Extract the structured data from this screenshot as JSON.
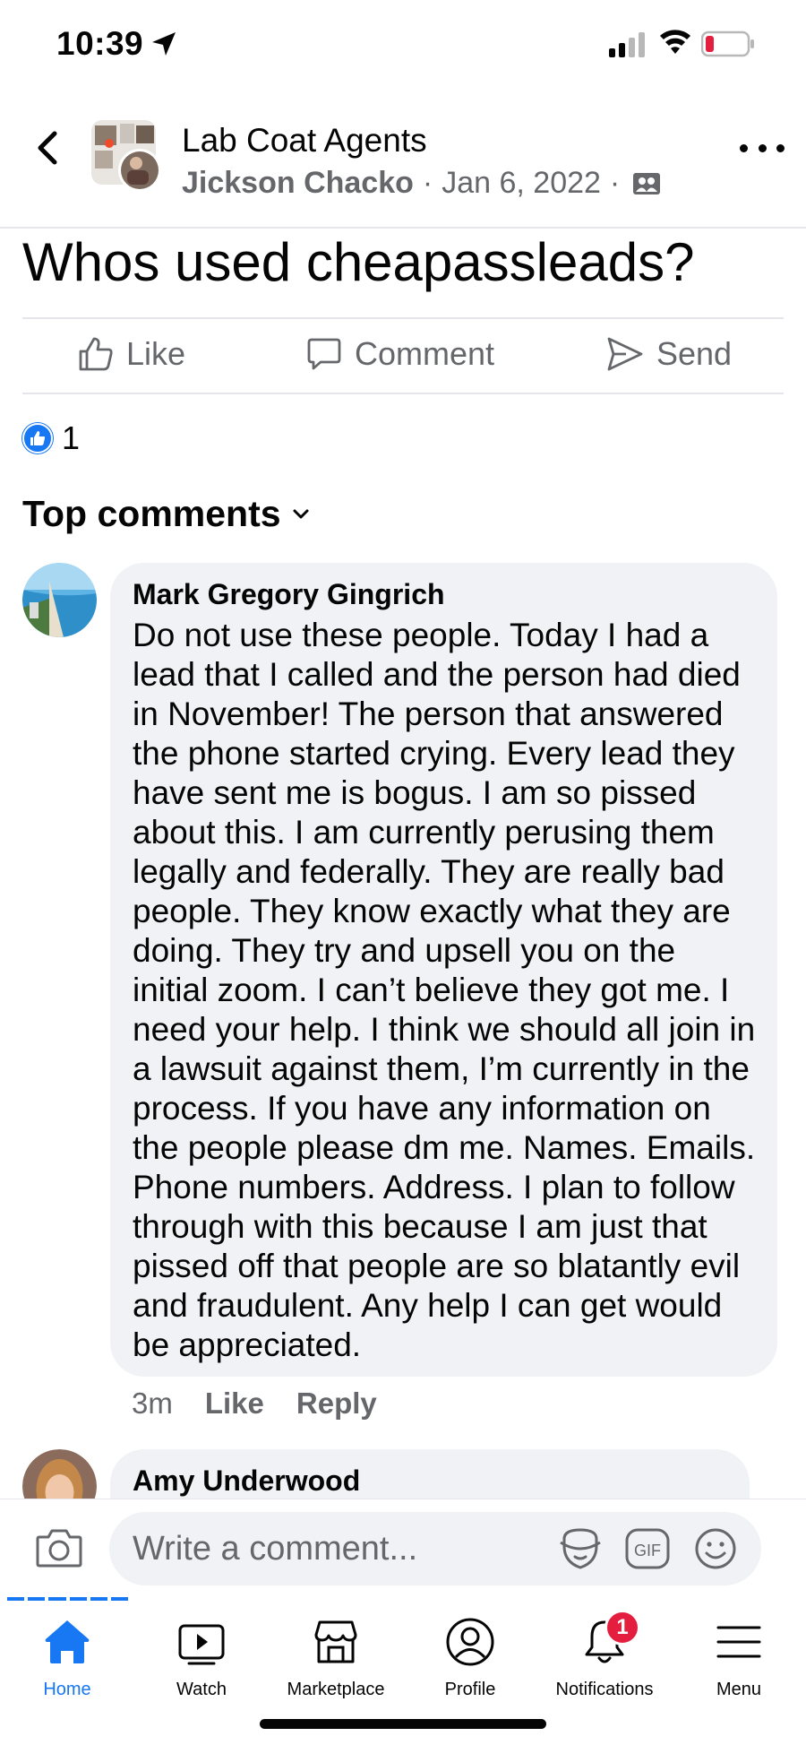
{
  "status_bar": {
    "time": "10:39",
    "battery_color": "#e41e3f"
  },
  "post": {
    "group_name": "Lab Coat Agents",
    "author": "Jickson Chacko",
    "separator": "·",
    "date": "Jan 6, 2022",
    "text": "Whos used cheapassleads?",
    "reaction_count": "1"
  },
  "actions": {
    "like": "Like",
    "comment": "Comment",
    "send": "Send"
  },
  "comments_section": {
    "heading": "Top comments"
  },
  "comments": [
    {
      "author": "Mark Gregory Gingrich",
      "text": "Do not use these people. Today I had a lead that I called and the person had died in November! The person that answered the phone started crying. Every lead they have sent me is bogus. I am so pissed about this. I am currently perusing them legally and federally. They are really bad people. They know exactly what they are doing. They try and upsell you on the initial zoom. I can’t believe they got me. I need your help. I think we should all join in a lawsuit against them, I’m currently in the process. If you have any information on the people please dm me. Names. Emails. Phone numbers. Address. I plan to follow through with this because I am just that pissed off that people are so blatantly evil and fraudulent. Any help I can get would be appreciated.",
      "time": "3m",
      "like_label": "Like",
      "reply_label": "Reply"
    },
    {
      "author": "Amy Underwood"
    }
  ],
  "composer": {
    "placeholder": "Write a comment...",
    "gif_label": "GIF"
  },
  "tabs": [
    {
      "label": "Home",
      "icon": "home-icon",
      "active": true
    },
    {
      "label": "Watch",
      "icon": "watch-icon"
    },
    {
      "label": "Marketplace",
      "icon": "marketplace-icon"
    },
    {
      "label": "Profile",
      "icon": "profile-icon"
    },
    {
      "label": "Notifications",
      "icon": "bell-icon",
      "badge": "1"
    },
    {
      "label": "Menu",
      "icon": "menu-icon"
    }
  ],
  "colors": {
    "accent": "#1877f2",
    "secondary_text": "#65676b",
    "bubble": "#f0f2f5",
    "badge": "#e41e3f"
  }
}
